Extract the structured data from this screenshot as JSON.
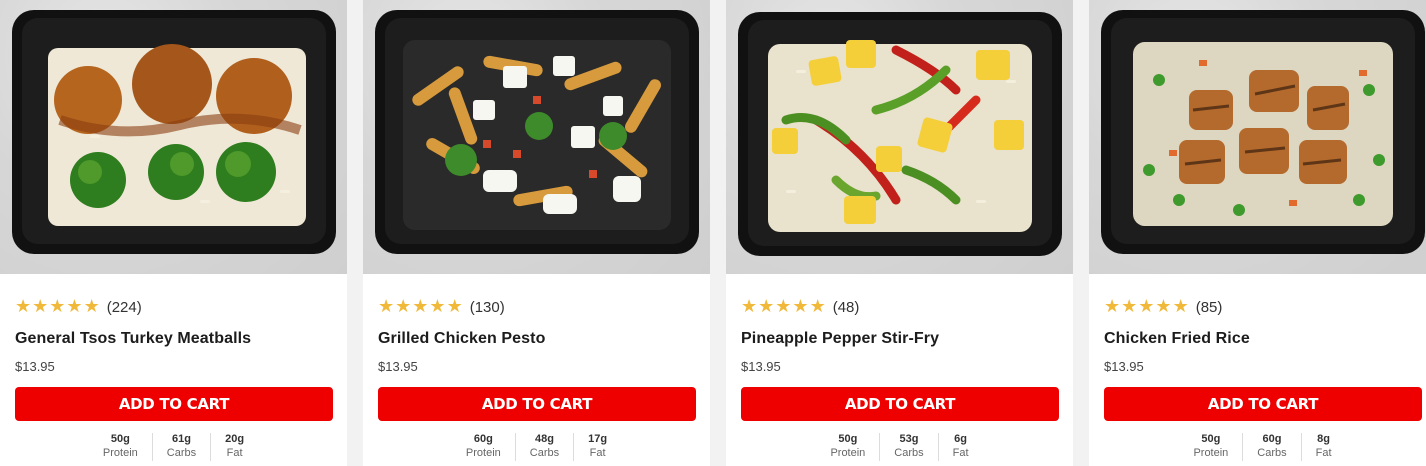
{
  "colors": {
    "accent": "#ee0000",
    "star": "#f0b93a"
  },
  "products": [
    {
      "image_alt": "General Tsos Turkey Meatballs meal in black tray",
      "rating_icon": "five-star-icons",
      "review_count": "(224)",
      "name": "General Tsos Turkey Meatballs",
      "price": "$13.95",
      "cta": "ADD TO CART",
      "macros": [
        {
          "value": "50g",
          "label": "Protein"
        },
        {
          "value": "61g",
          "label": "Carbs"
        },
        {
          "value": "20g",
          "label": "Fat"
        }
      ]
    },
    {
      "image_alt": "Grilled Chicken Pesto meal in black tray",
      "rating_icon": "five-star-icons",
      "review_count": "(130)",
      "name": "Grilled Chicken Pesto",
      "price": "$13.95",
      "cta": "ADD TO CART",
      "macros": [
        {
          "value": "60g",
          "label": "Protein"
        },
        {
          "value": "48g",
          "label": "Carbs"
        },
        {
          "value": "17g",
          "label": "Fat"
        }
      ]
    },
    {
      "image_alt": "Pineapple Pepper Stir-Fry meal in black tray",
      "rating_icon": "five-star-icons",
      "review_count": "(48)",
      "name": "Pineapple Pepper Stir-Fry",
      "price": "$13.95",
      "cta": "ADD TO CART",
      "macros": [
        {
          "value": "50g",
          "label": "Protein"
        },
        {
          "value": "53g",
          "label": "Carbs"
        },
        {
          "value": "6g",
          "label": "Fat"
        }
      ]
    },
    {
      "image_alt": "Chicken Fried Rice meal in black tray",
      "rating_icon": "five-star-icons",
      "review_count": "(85)",
      "name": "Chicken Fried Rice",
      "price": "$13.95",
      "cta": "ADD TO CART",
      "macros": [
        {
          "value": "50g",
          "label": "Protein"
        },
        {
          "value": "60g",
          "label": "Carbs"
        },
        {
          "value": "8g",
          "label": "Fat"
        }
      ]
    }
  ]
}
